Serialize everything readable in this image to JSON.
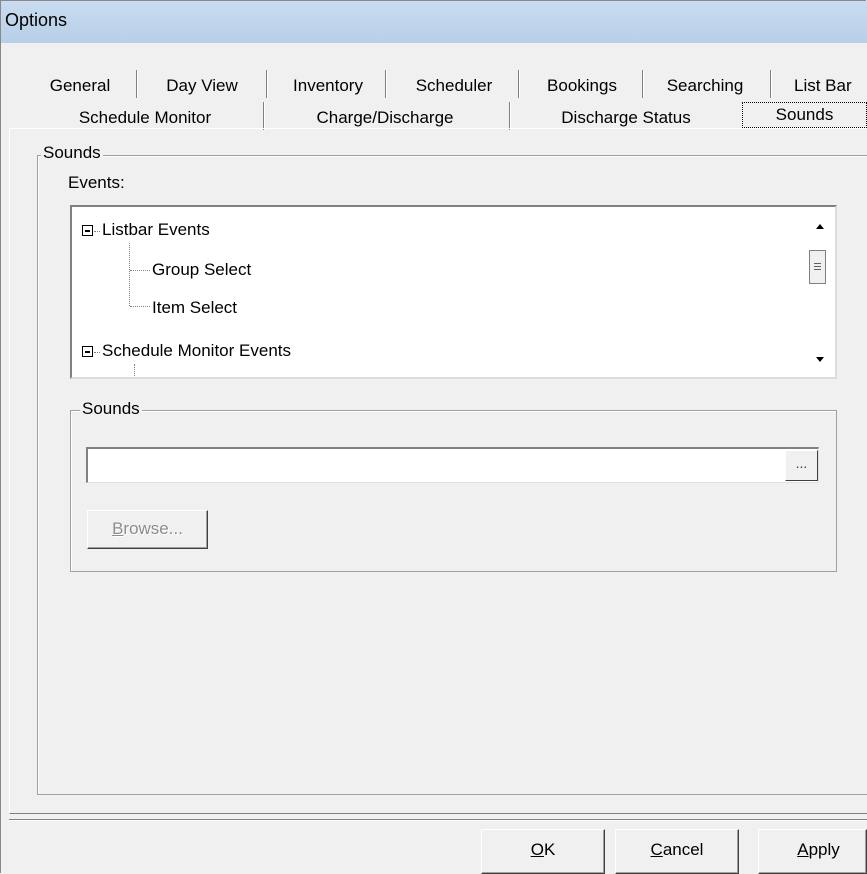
{
  "window": {
    "title": "Options"
  },
  "tabs": {
    "row1": [
      "General",
      "Day View",
      "Inventory",
      "Scheduler",
      "Bookings",
      "Searching",
      "List Bar"
    ],
    "row2": [
      "Schedule Monitor",
      "Charge/Discharge",
      "Discharge Status",
      "Sounds"
    ],
    "active": "Sounds"
  },
  "sounds_group": {
    "legend": "Sounds",
    "events_label": "Events:",
    "tree": [
      {
        "label": "Listbar Events",
        "level": 0,
        "expanded": true
      },
      {
        "label": "Group Select",
        "level": 1
      },
      {
        "label": "Item Select",
        "level": 1
      },
      {
        "label": "Schedule Monitor Events",
        "level": 0,
        "expanded": true
      }
    ]
  },
  "sound_file_group": {
    "legend": "Sounds",
    "path_value": "",
    "ellipsis_label": "...",
    "browse_label": "Browse...",
    "browse_mnemonic": "B",
    "browse_rest": "rowse..."
  },
  "footer": {
    "ok_mnemonic": "O",
    "ok_rest": "K",
    "cancel_mnemonic": "C",
    "cancel_rest": "ancel",
    "apply_mnemonic": "A",
    "apply_rest": "pply"
  }
}
